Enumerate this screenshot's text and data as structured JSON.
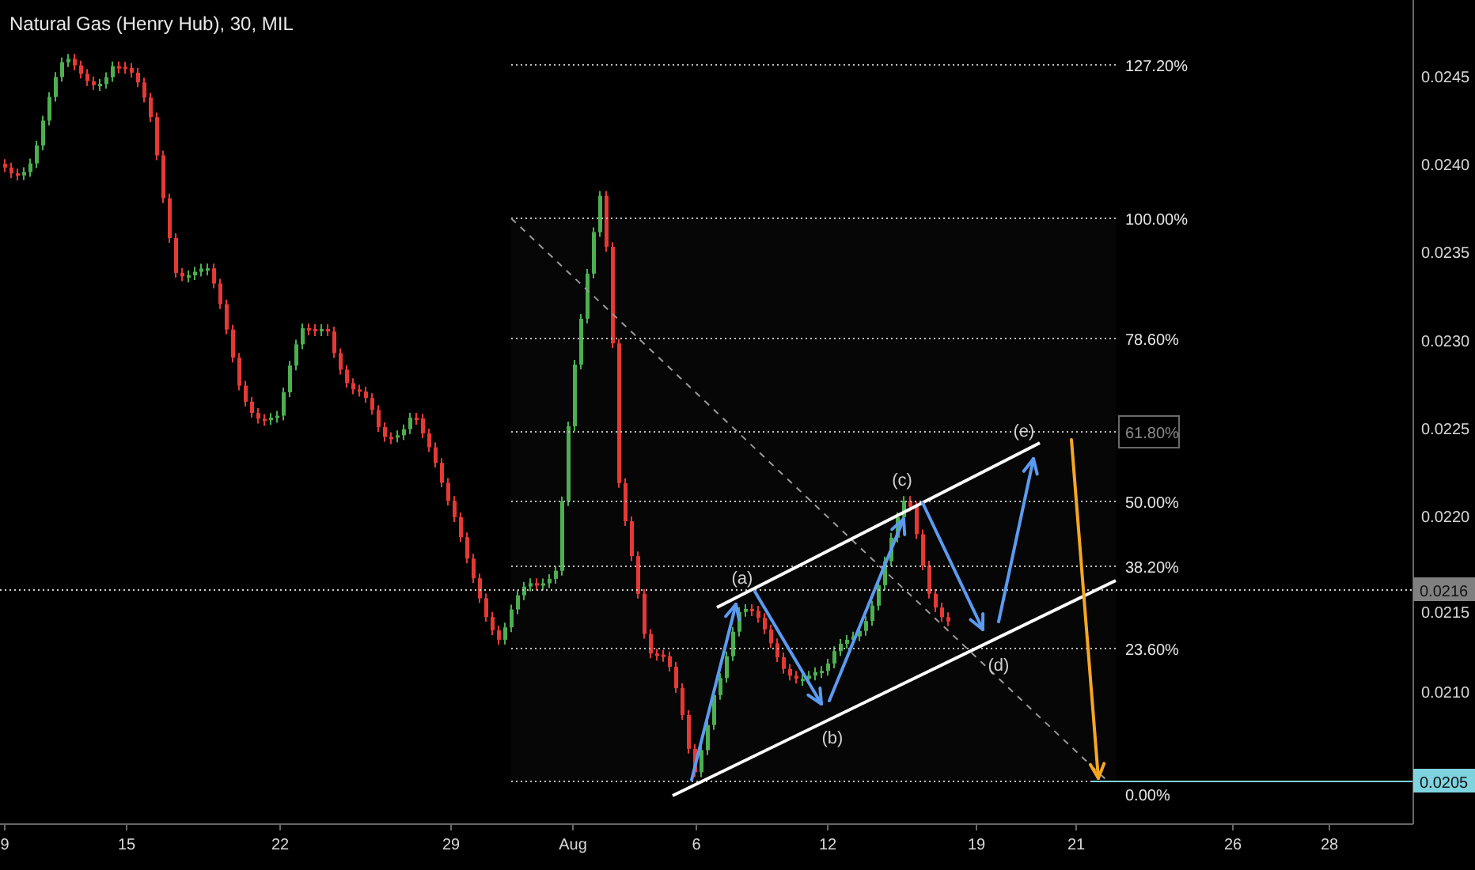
{
  "chart_title": "Natural Gas (Henry Hub), 30, MIL",
  "fib_levels": [
    {
      "label": "127.20%",
      "boxed": false
    },
    {
      "label": "100.00%",
      "boxed": false
    },
    {
      "label": "78.60%",
      "boxed": false
    },
    {
      "label": "61.80%",
      "boxed": true
    },
    {
      "label": "50.00%",
      "boxed": false
    },
    {
      "label": "38.20%",
      "boxed": false
    },
    {
      "label": "23.60%",
      "boxed": false
    },
    {
      "label": "0.00%",
      "boxed": false
    }
  ],
  "wave_labels": [
    "(a)",
    "(b)",
    "(c)",
    "(d)",
    "(e)"
  ],
  "price_axis": {
    "ticks": [
      "0.0245",
      "0.0240",
      "0.0235",
      "0.0230",
      "0.0225",
      "0.0220",
      "0.0215",
      "0.0210"
    ],
    "badges": [
      {
        "label": "0.0216",
        "color": "#808080"
      },
      {
        "label": "0.0205",
        "color": "#7fd3df"
      }
    ]
  },
  "time_axis": [
    "9",
    "15",
    "22",
    "29",
    "Aug",
    "6",
    "12",
    "19",
    "21",
    "26",
    "28"
  ]
}
